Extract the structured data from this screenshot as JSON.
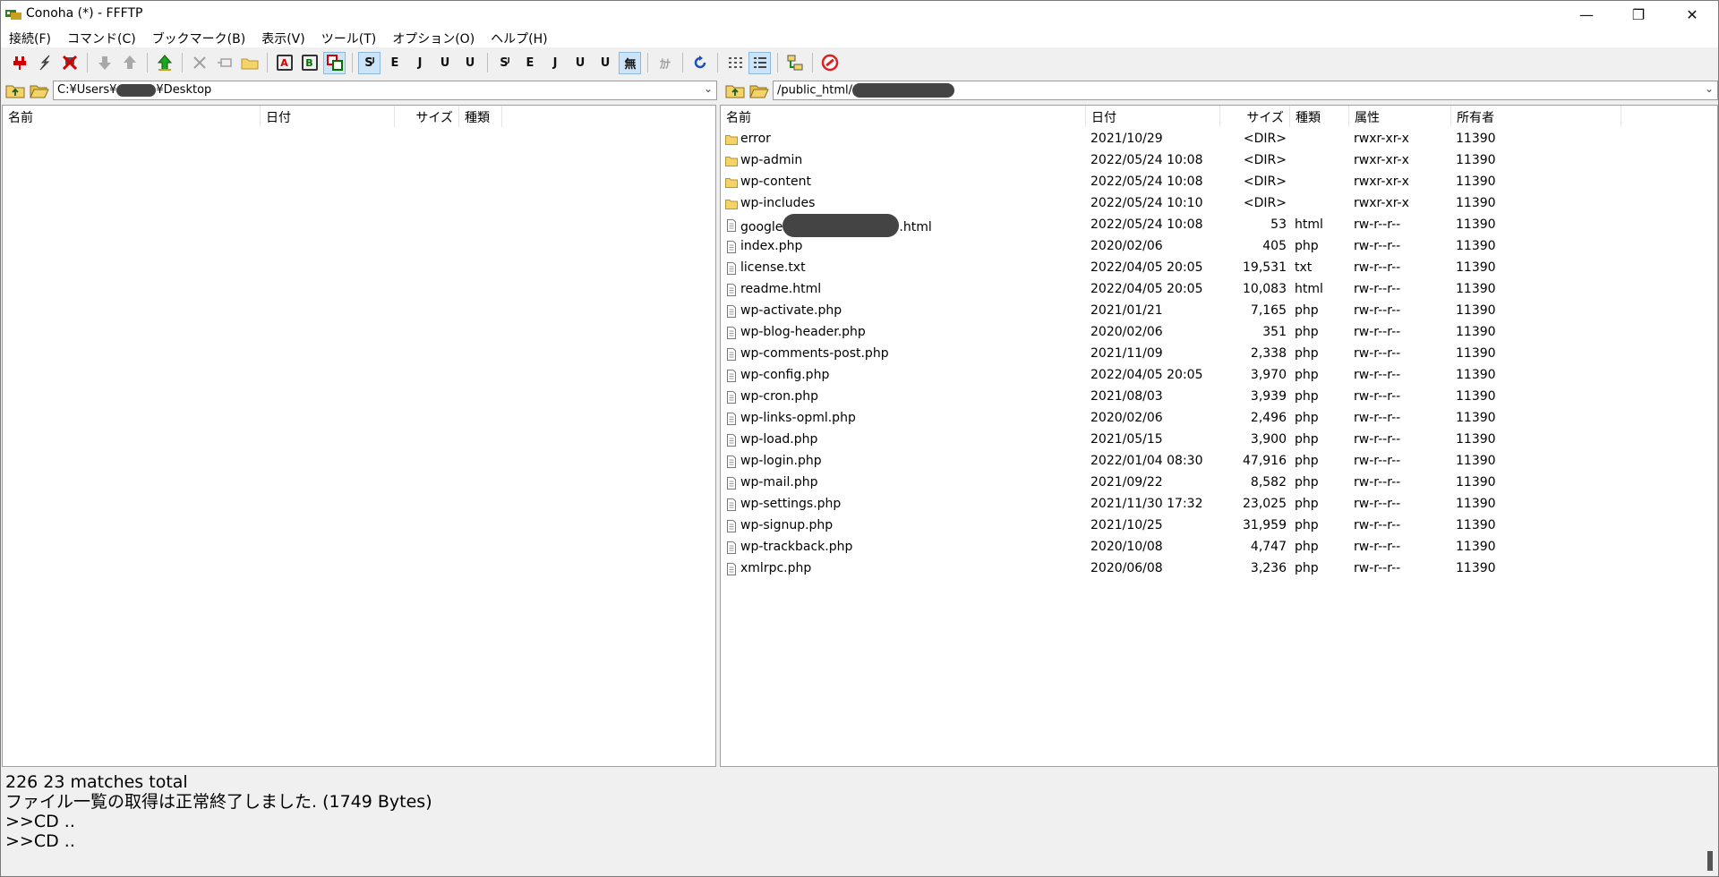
{
  "window": {
    "title": "Conoha (*) - FFFTP",
    "min_icon": "—",
    "max_icon": "❐",
    "close_icon": "✕"
  },
  "menu": [
    {
      "label": "接続(F)"
    },
    {
      "label": "コマンド(C)"
    },
    {
      "label": "ブックマーク(B)"
    },
    {
      "label": "表示(V)"
    },
    {
      "label": "ツール(T)"
    },
    {
      "label": "オプション(O)"
    },
    {
      "label": "ヘルプ(H)"
    }
  ],
  "toolbar": {
    "ascii_mode": "A",
    "binary_mode": "B",
    "kanji_sjis_label": "Sᴶ",
    "kanji_euc_label": "E",
    "kanji_jis_label": "J",
    "kanji_utf8n_label": "U",
    "kanji_utf8_label": "U",
    "no_conversion_label": "無",
    "kana_label": "ｶﾅ"
  },
  "local": {
    "path_prefix": "C:¥Users¥",
    "path_suffix": "¥Desktop",
    "columns": {
      "name": "名前",
      "date": "日付",
      "size": "サイズ",
      "type": "種類"
    }
  },
  "remote": {
    "path_prefix": "/public_html/",
    "columns": {
      "name": "名前",
      "date": "日付",
      "size": "サイズ",
      "type": "種類",
      "attr": "属性",
      "owner": "所有者"
    },
    "rows": [
      {
        "name": "error",
        "date": "2021/10/29",
        "size": "<DIR>",
        "type": "",
        "attr": "rwxr-xr-x",
        "owner": "11390",
        "kind": "folder"
      },
      {
        "name": "wp-admin",
        "date": "2022/05/24 10:08",
        "size": "<DIR>",
        "type": "",
        "attr": "rwxr-xr-x",
        "owner": "11390",
        "kind": "folder"
      },
      {
        "name": "wp-content",
        "date": "2022/05/24 10:08",
        "size": "<DIR>",
        "type": "",
        "attr": "rwxr-xr-x",
        "owner": "11390",
        "kind": "folder"
      },
      {
        "name": "wp-includes",
        "date": "2022/05/24 10:10",
        "size": "<DIR>",
        "type": "",
        "attr": "rwxr-xr-x",
        "owner": "11390",
        "kind": "folder"
      },
      {
        "name": "google",
        "name_suffix": ".html",
        "date": "2022/05/24 10:08",
        "size": "53",
        "type": "html",
        "attr": "rw-r--r--",
        "owner": "11390",
        "kind": "file",
        "redacted": true
      },
      {
        "name": "index.php",
        "date": "2020/02/06",
        "size": "405",
        "type": "php",
        "attr": "rw-r--r--",
        "owner": "11390",
        "kind": "file"
      },
      {
        "name": "license.txt",
        "date": "2022/04/05 20:05",
        "size": "19,531",
        "type": "txt",
        "attr": "rw-r--r--",
        "owner": "11390",
        "kind": "file"
      },
      {
        "name": "readme.html",
        "date": "2022/04/05 20:05",
        "size": "10,083",
        "type": "html",
        "attr": "rw-r--r--",
        "owner": "11390",
        "kind": "file"
      },
      {
        "name": "wp-activate.php",
        "date": "2021/01/21",
        "size": "7,165",
        "type": "php",
        "attr": "rw-r--r--",
        "owner": "11390",
        "kind": "file"
      },
      {
        "name": "wp-blog-header.php",
        "date": "2020/02/06",
        "size": "351",
        "type": "php",
        "attr": "rw-r--r--",
        "owner": "11390",
        "kind": "file"
      },
      {
        "name": "wp-comments-post.php",
        "date": "2021/11/09",
        "size": "2,338",
        "type": "php",
        "attr": "rw-r--r--",
        "owner": "11390",
        "kind": "file"
      },
      {
        "name": "wp-config.php",
        "date": "2022/04/05 20:05",
        "size": "3,970",
        "type": "php",
        "attr": "rw-r--r--",
        "owner": "11390",
        "kind": "file"
      },
      {
        "name": "wp-cron.php",
        "date": "2021/08/03",
        "size": "3,939",
        "type": "php",
        "attr": "rw-r--r--",
        "owner": "11390",
        "kind": "file"
      },
      {
        "name": "wp-links-opml.php",
        "date": "2020/02/06",
        "size": "2,496",
        "type": "php",
        "attr": "rw-r--r--",
        "owner": "11390",
        "kind": "file"
      },
      {
        "name": "wp-load.php",
        "date": "2021/05/15",
        "size": "3,900",
        "type": "php",
        "attr": "rw-r--r--",
        "owner": "11390",
        "kind": "file"
      },
      {
        "name": "wp-login.php",
        "date": "2022/01/04 08:30",
        "size": "47,916",
        "type": "php",
        "attr": "rw-r--r--",
        "owner": "11390",
        "kind": "file"
      },
      {
        "name": "wp-mail.php",
        "date": "2021/09/22",
        "size": "8,582",
        "type": "php",
        "attr": "rw-r--r--",
        "owner": "11390",
        "kind": "file"
      },
      {
        "name": "wp-settings.php",
        "date": "2021/11/30 17:32",
        "size": "23,025",
        "type": "php",
        "attr": "rw-r--r--",
        "owner": "11390",
        "kind": "file"
      },
      {
        "name": "wp-signup.php",
        "date": "2021/10/25",
        "size": "31,959",
        "type": "php",
        "attr": "rw-r--r--",
        "owner": "11390",
        "kind": "file"
      },
      {
        "name": "wp-trackback.php",
        "date": "2020/10/08",
        "size": "4,747",
        "type": "php",
        "attr": "rw-r--r--",
        "owner": "11390",
        "kind": "file"
      },
      {
        "name": "xmlrpc.php",
        "date": "2020/06/08",
        "size": "3,236",
        "type": "php",
        "attr": "rw-r--r--",
        "owner": "11390",
        "kind": "file"
      }
    ]
  },
  "log": [
    "226 23 matches total",
    "ファイル一覧の取得は正常終了しました. (1749 Bytes)",
    ">>CD ..",
    ">>CD .."
  ],
  "colors": {
    "folder": "#f5d36b",
    "folder_edge": "#b8952e",
    "accent_pressed": "#cce4f7"
  }
}
